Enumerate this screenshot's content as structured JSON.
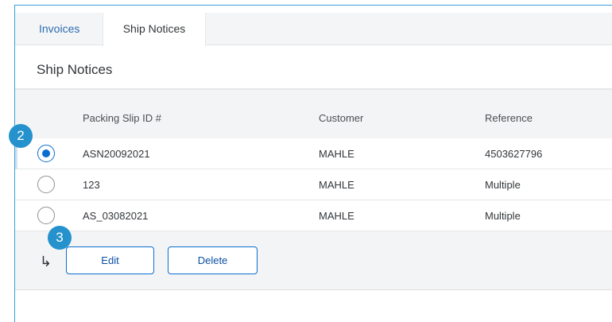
{
  "tabs": [
    {
      "label": "Invoices",
      "active": false
    },
    {
      "label": "Ship Notices",
      "active": true
    }
  ],
  "section_title": "Ship Notices",
  "table": {
    "columns": [
      "Packing Slip ID #",
      "Customer",
      "Reference"
    ],
    "rows": [
      {
        "selected": true,
        "packing_slip_id": "ASN20092021",
        "customer": "MAHLE",
        "reference": "4503627796"
      },
      {
        "selected": false,
        "packing_slip_id": "123",
        "customer": "MAHLE",
        "reference": "Multiple"
      },
      {
        "selected": false,
        "packing_slip_id": "AS_03082021",
        "customer": "MAHLE",
        "reference": "Multiple"
      }
    ]
  },
  "actions": {
    "arrow": "↳",
    "edit_label": "Edit",
    "delete_label": "Delete"
  },
  "callouts": {
    "step_2": "2",
    "step_3": "3"
  },
  "colors": {
    "accent": "#0a6ed1",
    "callout": "#2592cd",
    "frame": "#3aa0d6"
  }
}
